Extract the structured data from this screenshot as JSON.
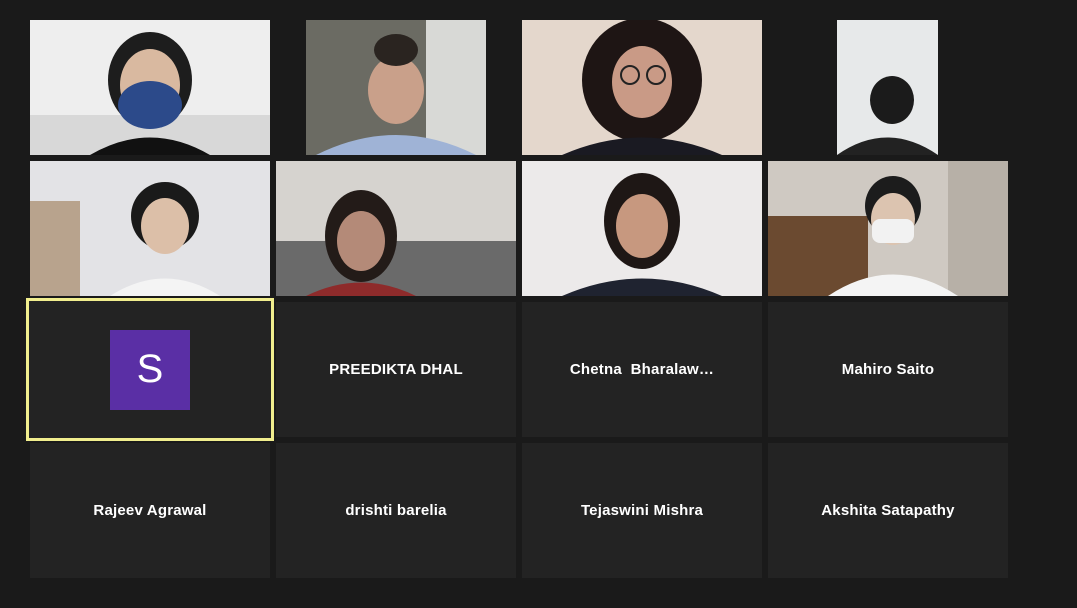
{
  "gallery": {
    "active_speaker_initial": "S",
    "name_tiles": [
      "PREEDIKTA DHAL",
      "Chetna  Bharalaw…",
      "Mahiro Saito",
      "Rajeev Agrawal",
      "drishti barelia",
      "Tejaswini Mishra",
      "Akshita Satapathy"
    ]
  },
  "colors": {
    "background": "#1a1a1a",
    "tile": "#232323",
    "active_border": "#f1ee8e",
    "avatar": "#5a2fa5"
  }
}
